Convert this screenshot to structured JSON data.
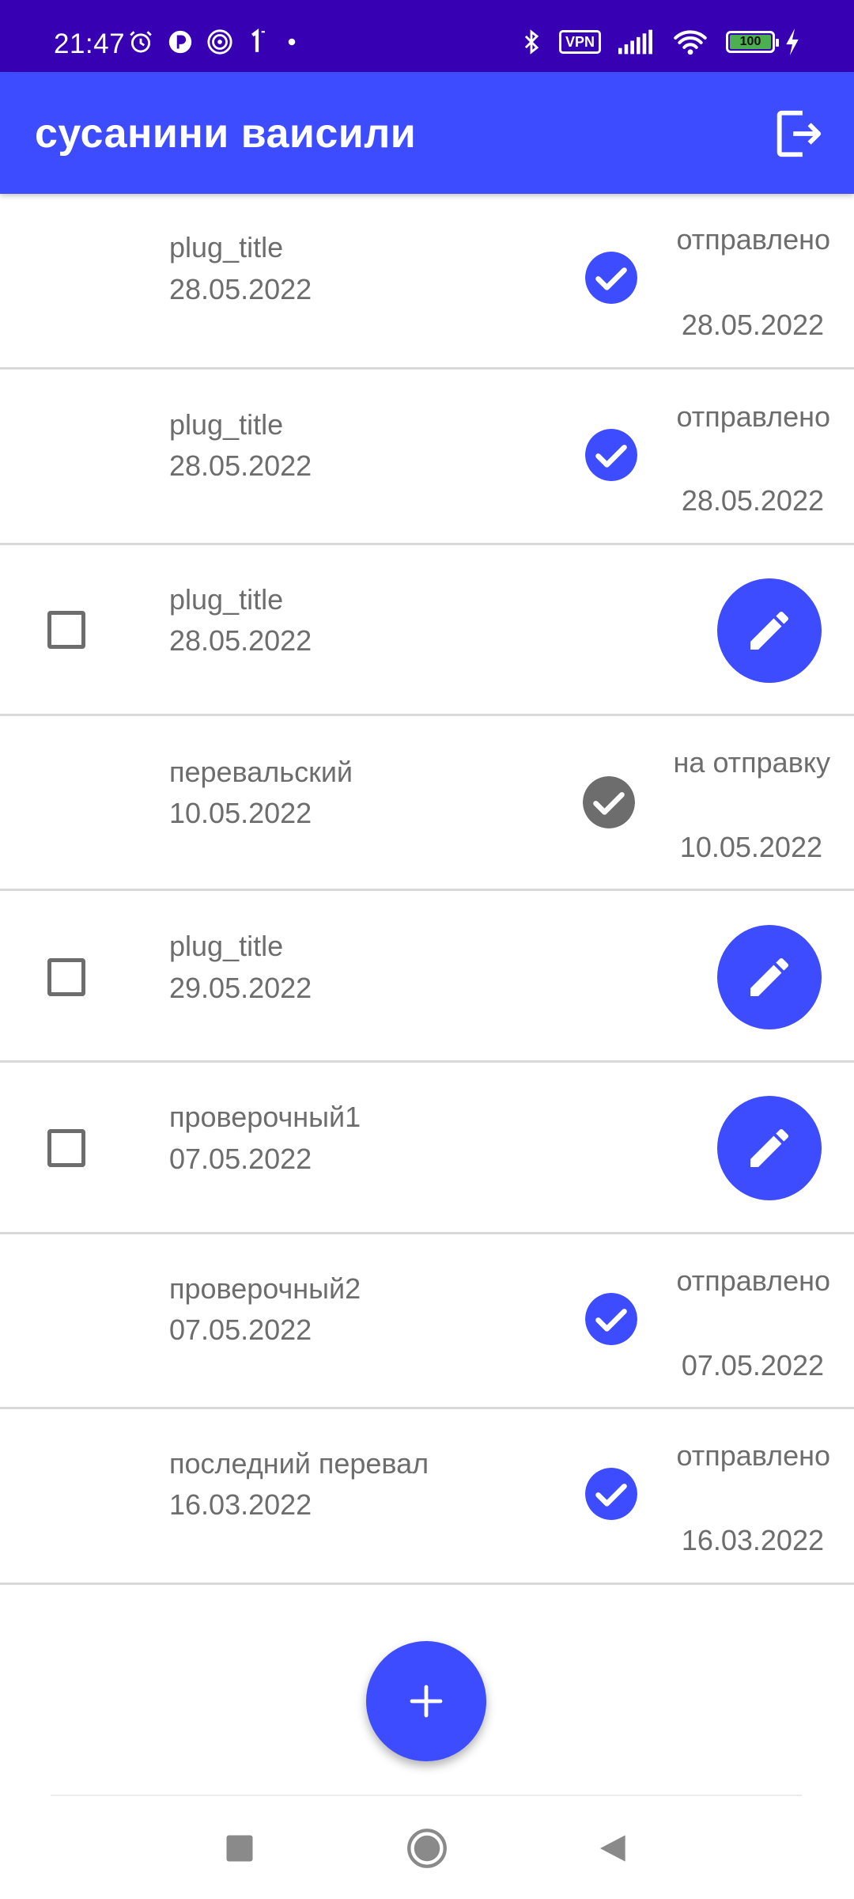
{
  "status_bar": {
    "time": "21:47",
    "left_icons": [
      "alarm-icon",
      "notification-app-icon",
      "spiral-app-icon",
      "one-app-icon",
      "dot-icon"
    ],
    "right_icons": [
      "bluetooth-icon",
      "vpn-icon",
      "signal-icon",
      "wifi-icon",
      "battery-icon",
      "charging-icon"
    ],
    "vpn_label": "VPN",
    "battery_level": "100"
  },
  "app_bar": {
    "title": "сусанини ваисили",
    "logout_icon": "logout-icon"
  },
  "colors": {
    "status_bar": "#3700B3",
    "primary": "#3D4CFE",
    "pending_gray": "#6d6d6d",
    "text_gray": "#6d6d6d",
    "divider": "#d9d9d9"
  },
  "rows": [
    {
      "title": "plug_title",
      "date": "28.05.2022",
      "state": "sent",
      "status_label": "отправлено",
      "status_date": "28.05.2022"
    },
    {
      "title": "plug_title",
      "date": "28.05.2022",
      "state": "sent",
      "status_label": "отправлено",
      "status_date": "28.05.2022"
    },
    {
      "title": "plug_title",
      "date": "28.05.2022",
      "state": "draft"
    },
    {
      "title": "перевальский",
      "date": "10.05.2022",
      "state": "pending",
      "status_label": "на отправку",
      "status_date": "10.05.2022"
    },
    {
      "title": "plug_title",
      "date": "29.05.2022",
      "state": "draft"
    },
    {
      "title": "проверочный1",
      "date": "07.05.2022",
      "state": "draft"
    },
    {
      "title": "проверочный2",
      "date": "07.05.2022",
      "state": "sent",
      "status_label": "отправлено",
      "status_date": "07.05.2022"
    },
    {
      "title": "последний перевал",
      "date": "16.03.2022",
      "state": "sent",
      "status_label": "отправлено",
      "status_date": "16.03.2022"
    }
  ],
  "fab": {
    "icon": "plus-icon"
  },
  "nav_bar": {
    "icons": [
      "recents-square-icon",
      "home-circle-icon",
      "back-triangle-icon"
    ]
  }
}
